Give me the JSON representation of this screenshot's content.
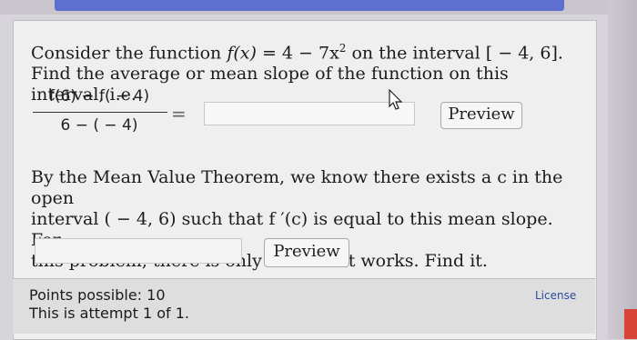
{
  "problem": {
    "text_before": "Consider the function ",
    "function_name": "f",
    "function_arg": "(x)",
    "function_expr": " = 4 − 7x",
    "exponent": "2",
    "text_interval": " on the interval [ − 4, 6].",
    "line2": "Find the average or mean slope of the function on this interval, i.e.",
    "fraction_numerator": "f(6) − f( − 4)",
    "fraction_denominator": "6 − ( − 4)",
    "equals": "="
  },
  "answer_1": {
    "value": ""
  },
  "preview_1": {
    "label": "Preview"
  },
  "mvt": {
    "line1": "By the Mean Value Theorem, we know there exists a c in the open",
    "line2": "interval ( − 4, 6) such that f ′(c) is equal to this mean slope. For",
    "line3": "this problem, there is only one c that works. Find it."
  },
  "answer_2": {
    "value": ""
  },
  "preview_2": {
    "label": "Preview"
  },
  "footer": {
    "points": "Points possible: 10",
    "attempt": "This is attempt 1 of 1.",
    "license": "License"
  },
  "colors": {
    "link": "#2a4aa0",
    "top_bar": "#5f6fd0",
    "side_tab": "#d84436"
  },
  "icons": {
    "cursor": "arrow-pointer-icon"
  }
}
